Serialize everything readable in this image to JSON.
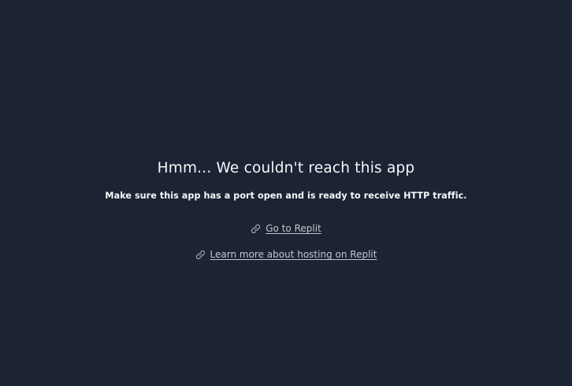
{
  "message": {
    "title": "Hmm... We couldn't reach this app",
    "subtitle": "Make sure this app has a port open and is ready to receive HTTP traffic."
  },
  "links": [
    {
      "label": "Go to Replit",
      "icon": "link-icon"
    },
    {
      "label": "Learn more about hosting on Replit",
      "icon": "link-icon"
    }
  ],
  "colors": {
    "background": "#1c2333",
    "text": "#f5f9fc",
    "link": "#c2c8cc"
  }
}
